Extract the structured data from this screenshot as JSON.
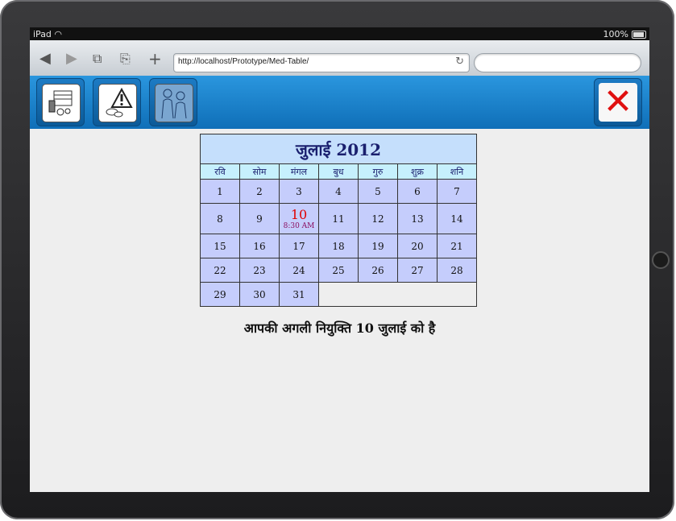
{
  "status": {
    "device": "iPad",
    "battery": "100%"
  },
  "browser": {
    "url": "http://localhost/Prototype/Med-Table/",
    "search_placeholder": ""
  },
  "toolbar": {
    "buttons": [
      {
        "icon": "medicine-table-icon"
      },
      {
        "icon": "warning-icon"
      },
      {
        "icon": "doctor-patient-icon"
      }
    ],
    "close_label": "✕"
  },
  "calendar": {
    "title": "जुलाई 2012",
    "weekdays": [
      "रवि",
      "सोम",
      "मंगल",
      "बुध",
      "गुरु",
      "शुक्र",
      "शनि"
    ],
    "weeks": [
      [
        "1",
        "2",
        "3",
        "4",
        "5",
        "6",
        "7"
      ],
      [
        "8",
        "9",
        "10",
        "11",
        "12",
        "13",
        "14"
      ],
      [
        "15",
        "16",
        "17",
        "18",
        "19",
        "20",
        "21"
      ],
      [
        "22",
        "23",
        "24",
        "25",
        "26",
        "27",
        "28"
      ],
      [
        "29",
        "30",
        "31",
        "",
        "",
        "",
        ""
      ]
    ],
    "appointment": {
      "day": "10",
      "time": "8:30 AM"
    }
  },
  "message": "आपकी अगली नियुक्ति 10 जुलाई को है",
  "colors": {
    "toolbar": "#1a84cf",
    "cell": "#c5cdfc",
    "header_cell": "#c6f0fd",
    "appointment": "#e00000"
  }
}
